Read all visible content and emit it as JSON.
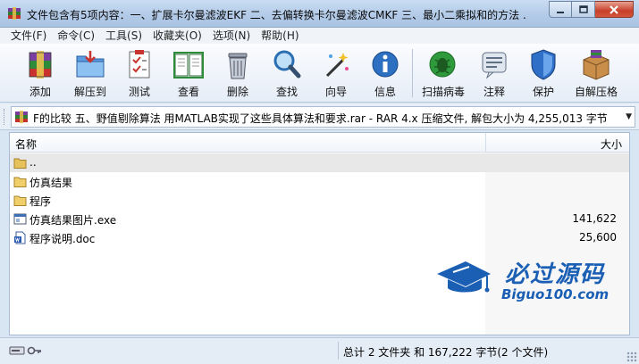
{
  "window": {
    "title": "文件包含有5项内容：一、扩展卡尔曼滤波EKF 二、去偏转换卡尔曼滤波CMKF 三、最小二乘拟和的方法 ...",
    "app_icon": "winrar-icon"
  },
  "menu": [
    {
      "label": "文件(F)"
    },
    {
      "label": "命令(C)"
    },
    {
      "label": "工具(S)"
    },
    {
      "label": "收藏夹(O)"
    },
    {
      "label": "选项(N)"
    },
    {
      "label": "帮助(H)"
    }
  ],
  "toolbar": [
    {
      "label": "添加",
      "icon": "add-archive-icon"
    },
    {
      "label": "解压到",
      "icon": "extract-to-icon"
    },
    {
      "label": "测试",
      "icon": "test-icon"
    },
    {
      "label": "查看",
      "icon": "view-book-icon"
    },
    {
      "label": "删除",
      "icon": "trash-icon"
    },
    {
      "label": "查找",
      "icon": "magnifier-icon"
    },
    {
      "label": "向导",
      "icon": "wizard-wand-icon"
    },
    {
      "label": "信息",
      "icon": "info-icon"
    },
    {
      "label": "扫描病毒",
      "icon": "virus-scan-icon"
    },
    {
      "label": "注释",
      "icon": "comment-icon"
    },
    {
      "label": "保护",
      "icon": "shield-icon"
    },
    {
      "label": "自解压格",
      "icon": "sfx-box-icon"
    }
  ],
  "address": {
    "path": "F的比较 五、野值剔除算法 用MATLAB实现了这些具体算法和要求.rar - RAR 4.x 压缩文件, 解包大小为 4,255,013 字节"
  },
  "columns": {
    "name": "名称",
    "size": "大小"
  },
  "files": [
    {
      "name": "..",
      "size": "",
      "icon": "folder-up-icon"
    },
    {
      "name": "仿真结果",
      "size": "",
      "icon": "folder-icon"
    },
    {
      "name": "程序",
      "size": "",
      "icon": "folder-icon"
    },
    {
      "name": "仿真结果图片.exe",
      "size": "141,622",
      "icon": "exe-file-icon"
    },
    {
      "name": "程序说明.doc",
      "size": "25,600",
      "icon": "doc-file-icon"
    }
  ],
  "watermark": {
    "title": "必过源码",
    "subtitle": "Biguo100.com"
  },
  "status": {
    "text": "总计 2 文件夹 和 167,222 字节(2 个文件)"
  },
  "colors": {
    "accent": "#1a5fb4",
    "close_button": "#c7402a",
    "titlebar": "#b3cbe8"
  }
}
